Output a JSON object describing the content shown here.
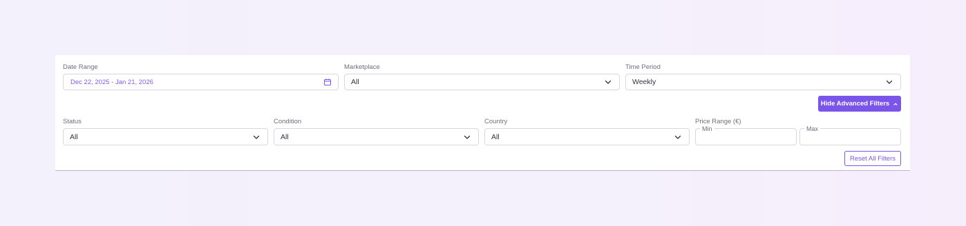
{
  "filters": {
    "date_range": {
      "label": "Date Range",
      "value": "Dec 22, 2025 - Jan 21, 2026",
      "icon": "calendar-icon"
    },
    "marketplace": {
      "label": "Marketplace",
      "value": "All"
    },
    "time_period": {
      "label": "Time Period",
      "value": "Weekly"
    },
    "status": {
      "label": "Status",
      "value": "All"
    },
    "condition": {
      "label": "Condition",
      "value": "All"
    },
    "country": {
      "label": "Country",
      "value": "All"
    },
    "price_range": {
      "label": "Price Range (€)",
      "min_placeholder": "Min",
      "max_placeholder": "Max"
    }
  },
  "actions": {
    "toggle_advanced_label": "Hide Advanced Filters",
    "reset_label": "Reset All Filters"
  },
  "colors": {
    "accent": "#7b55e9",
    "border": "#d7d8de",
    "label_text": "#6b6f7d"
  }
}
